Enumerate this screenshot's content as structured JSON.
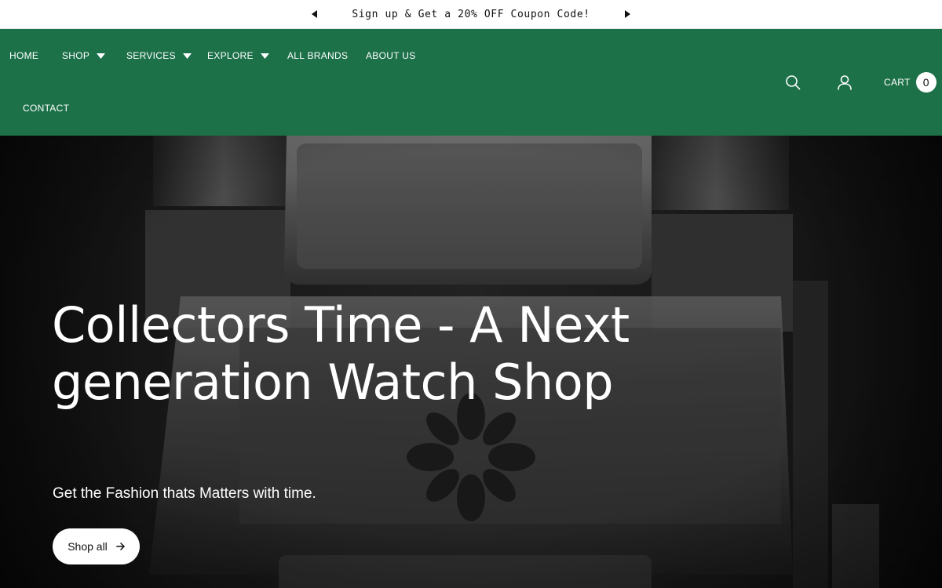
{
  "announcement": {
    "message": "Sign up & Get a 20% OFF Coupon Code!",
    "prev_icon": "caret-left-icon",
    "next_icon": "caret-right-icon"
  },
  "header": {
    "background_color": "#1d7149",
    "nav": [
      {
        "label": "HOME",
        "has_dropdown": false
      },
      {
        "label": "SHOP",
        "has_dropdown": true
      },
      {
        "label": "SERVICES",
        "has_dropdown": true
      },
      {
        "label": "EXPLORE",
        "has_dropdown": true
      },
      {
        "label": "ALL BRANDS",
        "has_dropdown": false
      },
      {
        "label": "ABOUT US",
        "has_dropdown": false
      },
      {
        "label": "CONTACT",
        "has_dropdown": false
      }
    ],
    "icons": {
      "search": "search-icon",
      "account": "user-icon"
    },
    "cart": {
      "label": "CART",
      "count": "0"
    }
  },
  "hero": {
    "title": "Collectors Time - A Next generation Watch Shop",
    "subtitle": "Get the Fashion thats Matters with time.",
    "button_label": "Shop all",
    "button_icon": "arrow-right-icon",
    "image": "watch-bracelet-closeup"
  }
}
